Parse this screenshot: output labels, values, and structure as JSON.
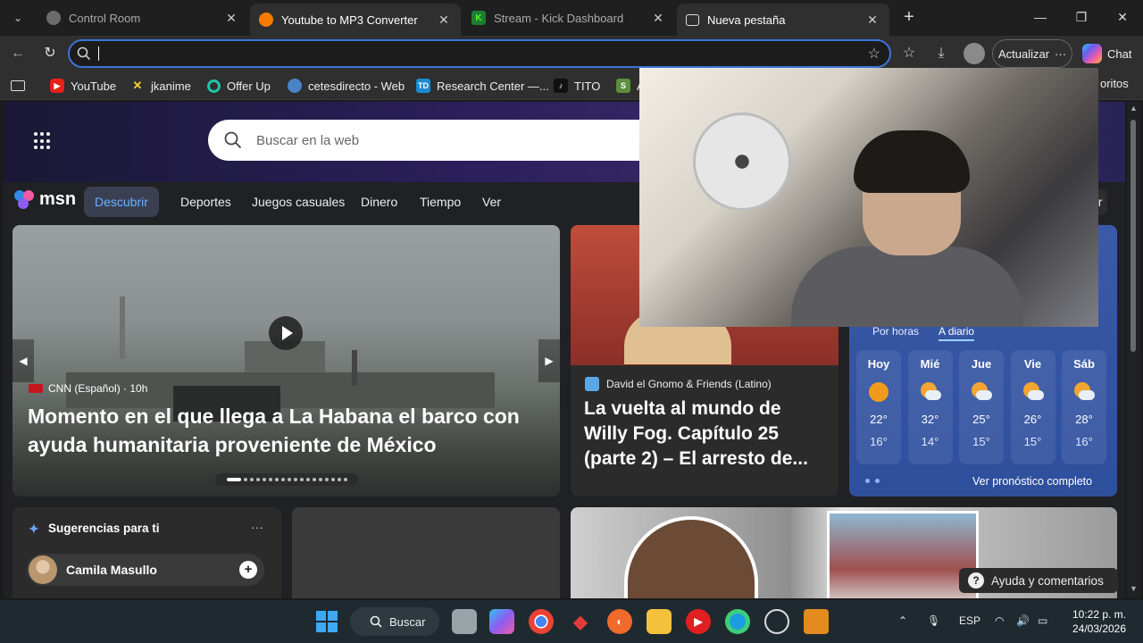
{
  "tabs": [
    {
      "title": "Control Room",
      "favicon": "control-room-icon",
      "active": false
    },
    {
      "title": "Youtube to MP3 Converter",
      "favicon": "converter-icon",
      "active": true
    },
    {
      "title": "Stream - Kick Dashboard",
      "favicon": "kick-icon",
      "active": false
    },
    {
      "title": "Nueva pestaña",
      "favicon": "new-tab-page-icon",
      "active": true
    }
  ],
  "toolbar": {
    "address_value": "",
    "update_label": "Actualizar",
    "chat_label": "Chat"
  },
  "bookmarks": [
    {
      "label": "YouTube",
      "icon": "youtube-icon"
    },
    {
      "label": "jkanime",
      "icon": "jkanime-icon"
    },
    {
      "label": "Offer Up",
      "icon": "offerup-icon"
    },
    {
      "label": "cetesdirecto - Web",
      "icon": "cetes-icon"
    },
    {
      "label": "Research Center —...",
      "icon": "td-icon"
    },
    {
      "label": "TITO",
      "icon": "tiktok-icon"
    },
    {
      "label": "A",
      "icon": "shopify-icon"
    }
  ],
  "bookmarks_right": "oritos",
  "msn": {
    "search_placeholder": "Buscar en la web",
    "logo_text": "msn",
    "nav": [
      "Descubrir",
      "Deportes",
      "Juegos casuales",
      "Dinero",
      "Tiempo",
      "Ver"
    ],
    "partial_button": "ar",
    "hero": {
      "source": "CNN (Español) · 10h",
      "title": "Momento en el que llega a La Habana el barco con ayuda humanitaria proveniente de México"
    },
    "card2": {
      "source": "David el Gnomo & Friends (Latino)",
      "title": "La vuelta al mundo de Willy Fog. Capítulo 25 (parte 2) – El arresto de..."
    },
    "weather": {
      "tabs": [
        "Por horas",
        "A diario"
      ],
      "days": [
        {
          "name": "Hoy",
          "icon": "sunny-icon",
          "hi": "22°",
          "lo": "16°"
        },
        {
          "name": "Mié",
          "icon": "partly-cloudy-icon",
          "hi": "32°",
          "lo": "14°"
        },
        {
          "name": "Jue",
          "icon": "partly-cloudy-icon",
          "hi": "25°",
          "lo": "15°"
        },
        {
          "name": "Vie",
          "icon": "partly-cloudy-icon",
          "hi": "26°",
          "lo": "15°"
        },
        {
          "name": "Sáb",
          "icon": "partly-cloudy-icon",
          "hi": "28°",
          "lo": "16°"
        }
      ],
      "forecast_link": "Ver pronóstico completo"
    },
    "suggestions": {
      "title": "Sugerencias para ti",
      "person": "Camila Masullo"
    },
    "help_label": "Ayuda y comentarios"
  },
  "taskbar": {
    "search_label": "Buscar",
    "language": "ESP",
    "time": "10:22 p. m.",
    "date": "24/03/2026"
  },
  "colors": {
    "accent": "#3b73d9",
    "weather_bg": "#3a5aa8",
    "msn_active": "#6cb0ff"
  }
}
